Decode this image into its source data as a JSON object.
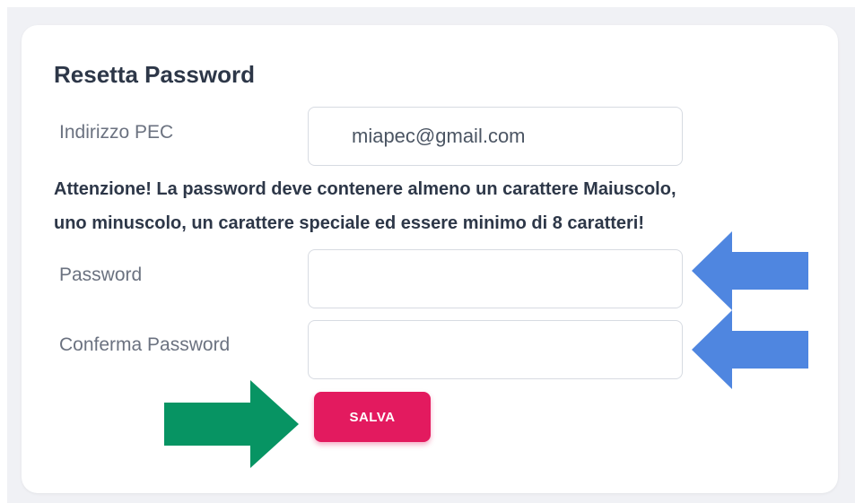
{
  "form": {
    "title": "Resetta Password",
    "pec_label": "Indirizzo PEC",
    "pec_value": "miapec@gmail.com",
    "warning_line1": "Attenzione! La password deve contenere almeno un carattere Maiuscolo,",
    "warning_line2": "uno minuscolo, un carattere speciale ed essere minimo di 8 caratteri!",
    "password_label": "Password",
    "password_value": "",
    "confirm_label": "Conferma Password",
    "confirm_value": "",
    "save_label": "SALVA"
  },
  "annotations": {
    "blue_arrow_color": "#4f86e0",
    "green_arrow_color": "#079463",
    "button_color": "#e31a5f"
  }
}
